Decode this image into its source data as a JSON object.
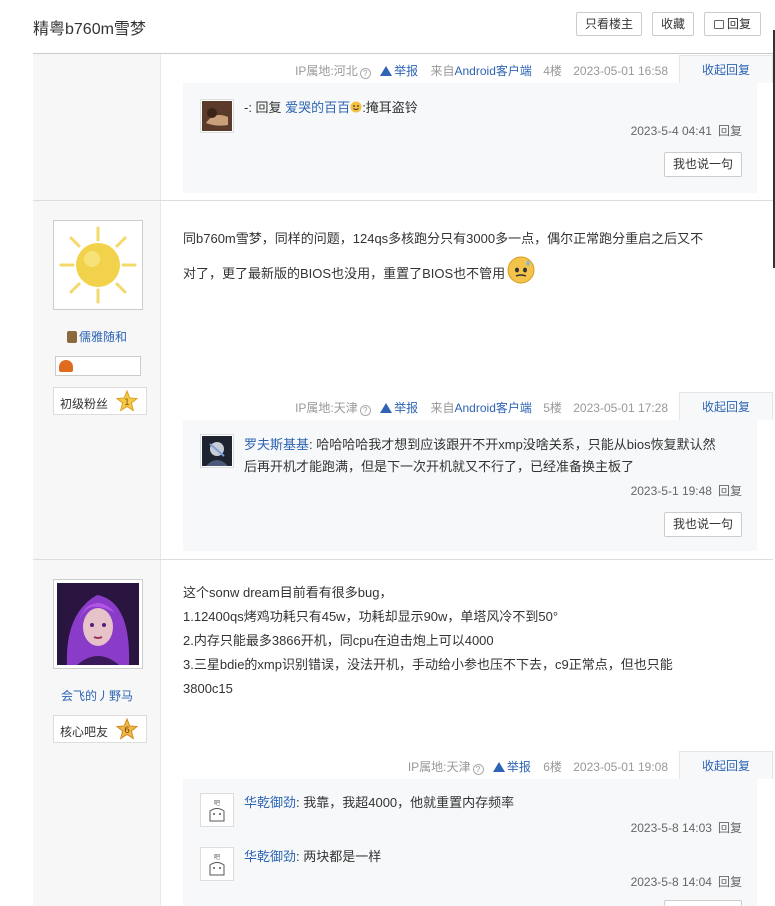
{
  "header": {
    "title": "精粤b760m雪梦",
    "btn_only_op": "只看楼主",
    "btn_collect": "收藏",
    "btn_reply": "回复"
  },
  "floors": [
    {
      "meta": {
        "ip": "IP属地:河北",
        "report": "举报",
        "source_prefix": "来自",
        "source": "Android客户端",
        "floor": "4楼",
        "time": "2023-05-01 16:58",
        "fold": "收起回复"
      },
      "comments": [
        {
          "prefix": "-: 回复 ",
          "user": "爱哭的百百",
          "text": ":掩耳盗铃",
          "time": "2023-5-4 04:41",
          "reply": "回复"
        }
      ],
      "say_btn": "我也说一句"
    },
    {
      "user": {
        "name": "儒雅随和",
        "level_title": "初级粉丝",
        "level": "1"
      },
      "content": [
        "同b760m雪梦，同样的问题，124qs多核跑分只有3000多一点，偶尔正常跑分重启之后又不",
        "对了，更了最新版的BIOS也没用，重置了BIOS也不管用"
      ],
      "meta": {
        "ip": "IP属地:天津",
        "report": "举报",
        "source_prefix": "来自",
        "source": "Android客户端",
        "floor": "5楼",
        "time": "2023-05-01 17:28",
        "fold": "收起回复"
      },
      "comments": [
        {
          "user": "罗夫斯基基",
          "text": ": 哈哈哈哈我才想到应该跟开不开xmp没啥关系，只能从bios恢复默认然",
          "text2": "后再开机才能跑满，但是下一次开机就又不行了，已经准备换主板了",
          "time": "2023-5-1 19:48",
          "reply": "回复"
        }
      ],
      "say_btn": "我也说一句"
    },
    {
      "user": {
        "name": "会飞的丿野马",
        "level_title": "核心吧友",
        "level": "6"
      },
      "content": [
        "这个sonw dream目前看有很多bug，",
        "1.12400qs烤鸡功耗只有45w，功耗却显示90w，单塔风冷不到50°",
        "2.内存只能最多3866开机，同cpu在迫击炮上可以4000",
        "3.三星bdie的xmp识别错误，没法开机，手动给小参也压不下去，c9正常点，但也只能",
        "3800c15"
      ],
      "meta": {
        "ip": "IP属地:天津",
        "report": "举报",
        "floor": "6楼",
        "time": "2023-05-01 19:08",
        "fold": "收起回复"
      },
      "comments": [
        {
          "user": "华乾御劲",
          "text": ": 我靠，我超4000，他就重置内存频率",
          "time": "2023-5-8 14:03",
          "reply": "回复"
        },
        {
          "user": "华乾御劲",
          "text": ": 两块都是一样",
          "time": "2023-5-8 14:04",
          "reply": "回复"
        }
      ]
    }
  ]
}
